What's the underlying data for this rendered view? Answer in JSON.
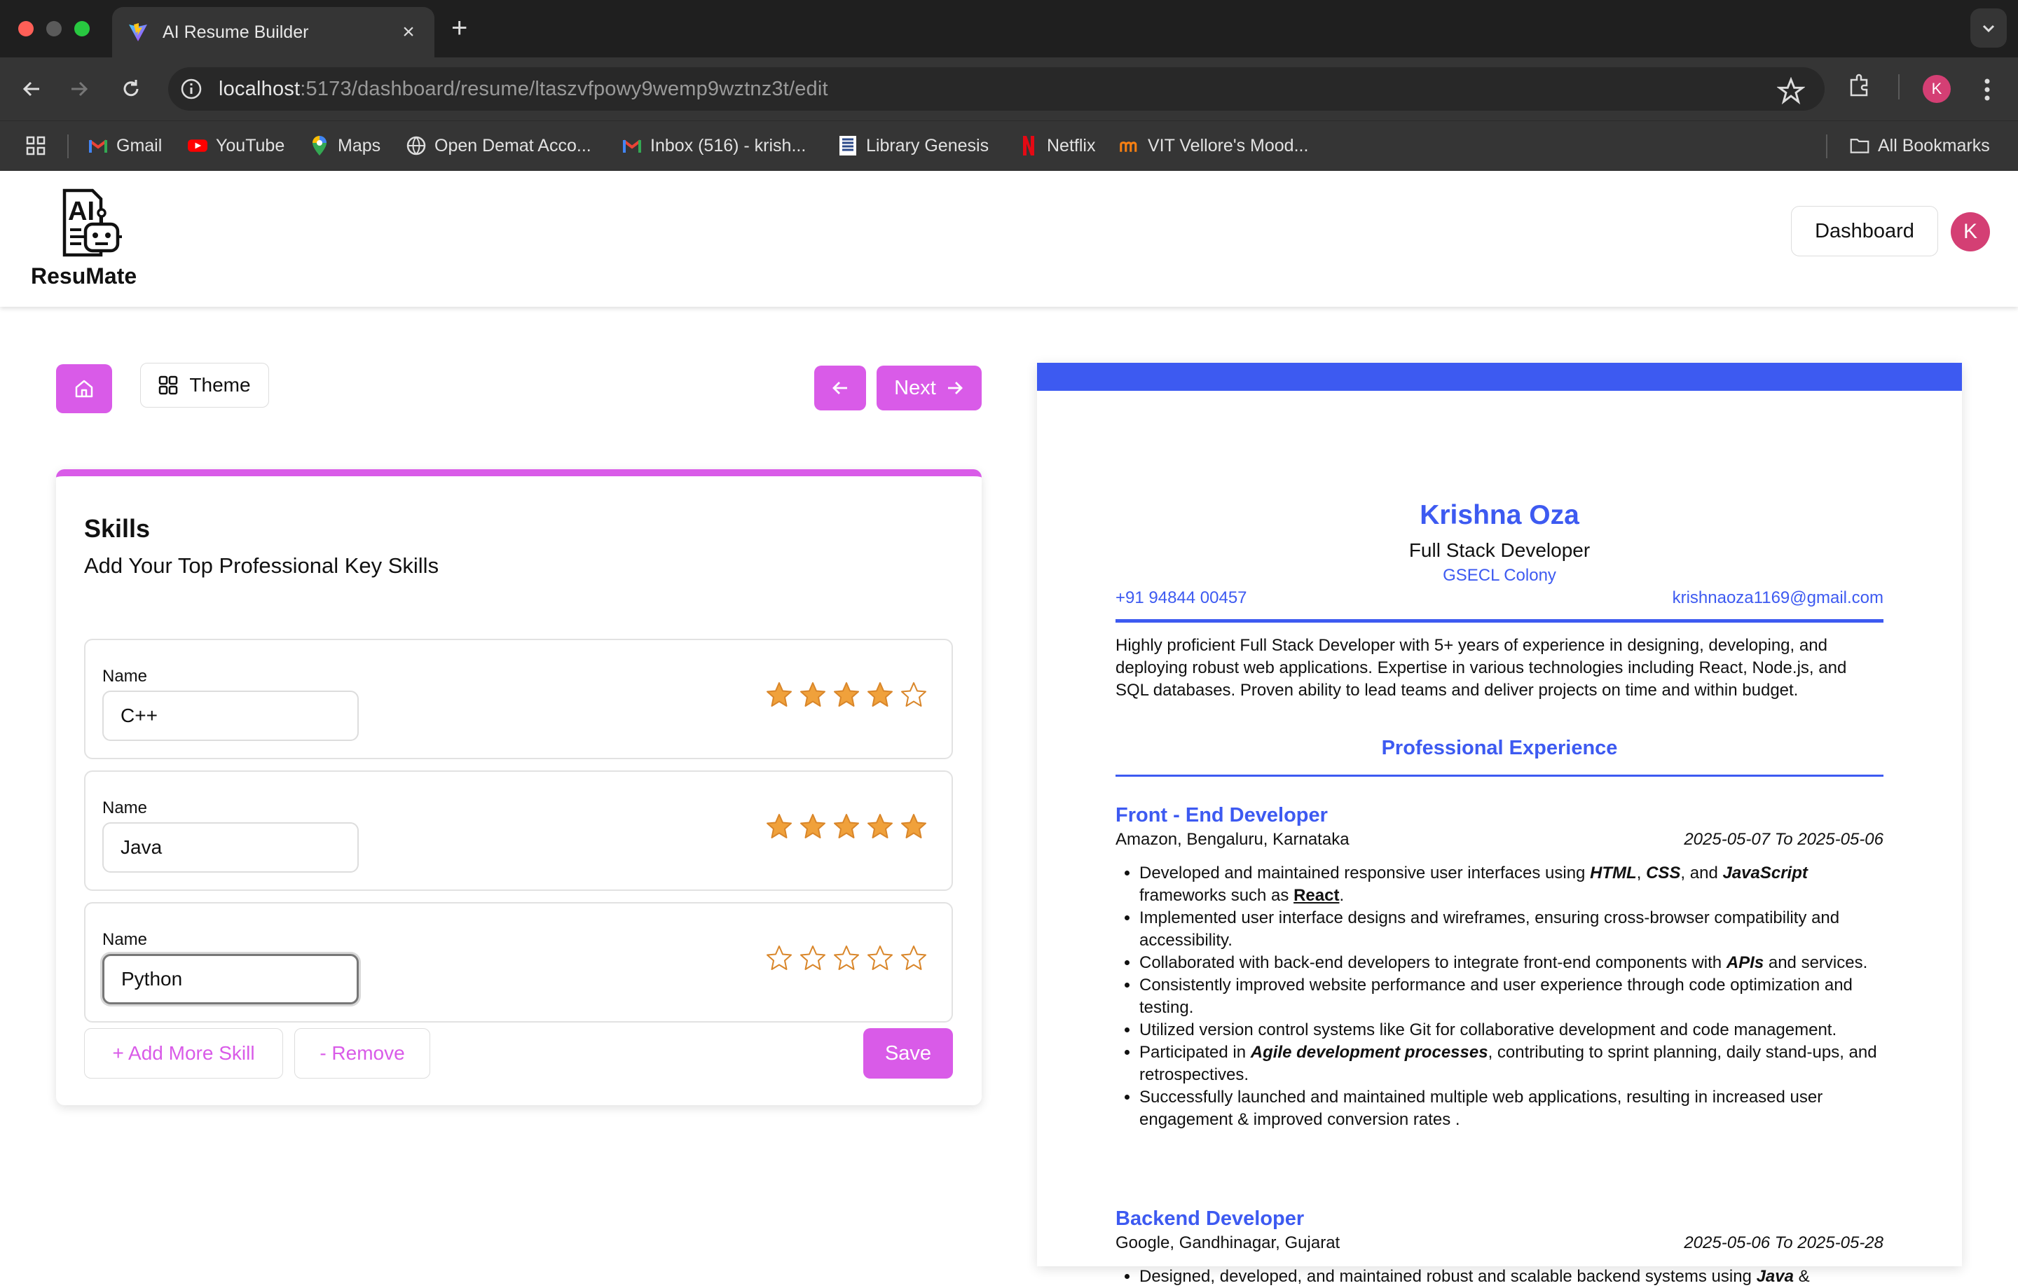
{
  "browser": {
    "tab_title": "AI Resume Builder",
    "url_host": "localhost",
    "url_rest": ":5173/dashboard/resume/ltaszvfpowy9wemp9wztnz3t/edit",
    "profile_initial": "K",
    "bookmarks": [
      {
        "label": "Gmail",
        "icon": "gmail-icon"
      },
      {
        "label": "YouTube",
        "icon": "youtube-icon"
      },
      {
        "label": "Maps",
        "icon": "maps-icon"
      },
      {
        "label": "Open Demat Acco...",
        "icon": "globe-icon"
      },
      {
        "label": "Inbox (516) - krish...",
        "icon": "gmail-icon"
      },
      {
        "label": "Library Genesis",
        "icon": "book-icon"
      },
      {
        "label": "Netflix",
        "icon": "netflix-icon"
      },
      {
        "label": "VIT Vellore's Mood...",
        "icon": "moodle-icon"
      }
    ],
    "all_bookmarks": "All Bookmarks"
  },
  "app": {
    "logo_mark": "AI",
    "logo_text": "ResuMate",
    "dashboard_label": "Dashboard",
    "avatar_initial": "K"
  },
  "editor": {
    "theme_label": "Theme",
    "next_label": "Next",
    "title": "Skills",
    "subtitle": "Add Your Top Professional Key Skills",
    "field_label": "Name",
    "skills": [
      {
        "name": "C++",
        "rating": 4
      },
      {
        "name": "Java",
        "rating": 5
      },
      {
        "name": "Python",
        "rating": 0
      }
    ],
    "add_label": "+ Add More Skill",
    "remove_label": "- Remove",
    "save_label": "Save"
  },
  "resume": {
    "name": "Krishna Oza",
    "role": "Full Stack Developer",
    "address": "GSECL Colony",
    "phone": "+91 94844 00457",
    "email": "krishnaoza1169@gmail.com",
    "summary": "Highly proficient Full Stack Developer with 5+ years of experience in designing, developing, and deploying robust web applications. Expertise in various technologies including React, Node.js, and SQL databases. Proven ability to lead teams and deliver projects on time and within budget.",
    "experience_heading": "Professional Experience",
    "jobs": [
      {
        "title": "Front - End Developer",
        "company": "Amazon, Bengaluru, Karnataka",
        "dates": "2025-05-07 To 2025-05-06",
        "bullets": [
          "Developed and maintained responsive user interfaces using <b><i>HTML</i></b>, <b><i>CSS</i></b>, and <b><i>JavaScript</i></b> frameworks such as <b><u>React</u></b>.",
          "Implemented user interface designs and wireframes, ensuring cross-browser compatibility and accessibility.",
          "Collaborated with back-end developers to integrate front-end components with <b><i>APIs</i></b> and services.",
          "Consistently improved website performance and user experience through code optimization and testing.",
          "Utilized version control systems like Git for collaborative development and code management.",
          "Participated in <b><i>Agile development processes</i></b>, contributing to sprint planning, daily stand-ups, and retrospectives.",
          "Successfully launched and maintained multiple web applications, resulting in increased user engagement &amp; improved conversion rates ."
        ]
      },
      {
        "title": "Backend Developer",
        "company": "Google, Gandhinagar, Gujarat",
        "dates": "2025-05-06 To 2025-05-28",
        "bullets": [
          "Designed, developed, and maintained robust and scalable backend systems using <b><i>Java</i></b> &amp;"
        ]
      }
    ]
  },
  "colors": {
    "accent": "#d95be8",
    "resume_accent": "#3d5af1",
    "star_fill": "#f0a13b"
  }
}
